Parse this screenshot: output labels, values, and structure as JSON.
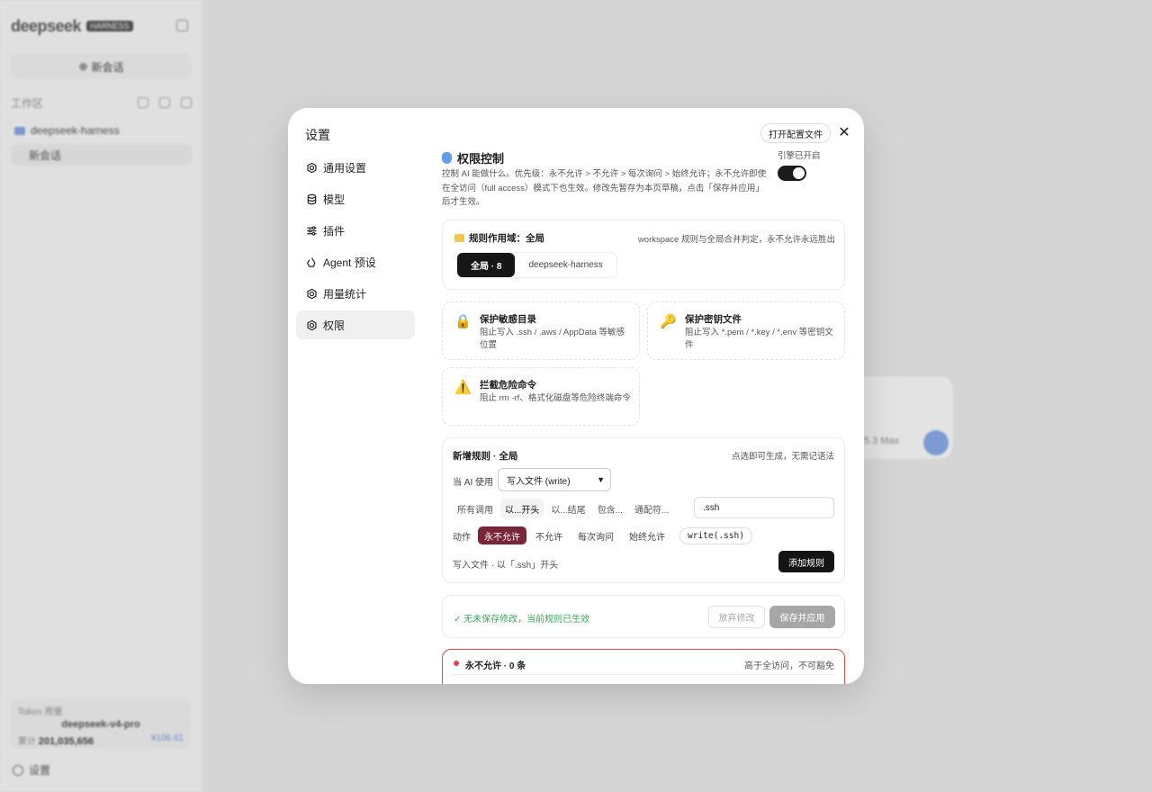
{
  "background": {
    "brand": "deepseek",
    "brand_badge": "HARNESS",
    "new_chat": "新会话",
    "workspace_label": "工作区",
    "workspace_item": "deepseek-harness",
    "chat_item": "新会话",
    "token_title": "Token 用量",
    "token_model": "deepseek-v4-pro",
    "token_total_label": "累计",
    "token_total": "201,035,656",
    "token_cost": "¥106.61",
    "settings": "设置",
    "composer_model": "5.3 Max"
  },
  "modal": {
    "title": "设置",
    "open_config": "打开配置文件",
    "nav": [
      {
        "label": "通用设置",
        "icon": "gear-icon"
      },
      {
        "label": "模型",
        "icon": "database-icon"
      },
      {
        "label": "插件",
        "icon": "sliders-icon"
      },
      {
        "label": "Agent 预设",
        "icon": "recycle-icon"
      },
      {
        "label": "用量统计",
        "icon": "gear-icon"
      },
      {
        "label": "权限",
        "icon": "gear-icon"
      }
    ],
    "active_nav": "权限"
  },
  "permissions": {
    "title": "权限控制",
    "description": "控制 AI 能做什么。优先级：永不允许 > 不允许 > 每次询问 > 始终允许；永不允许即使在全访问（full access）模式下也生效。修改先暂存为本页草稿，点击「保存并应用」后才生效。",
    "engine_label": "引擎已开启",
    "engine_on": true,
    "scope": {
      "title": "规则作用域：全局",
      "note": "workspace 规则与全局合并判定，永不允许永远胜出",
      "tabs": [
        "全局 · 8",
        "deepseek-harness"
      ]
    },
    "presets": [
      {
        "icon": "🔒",
        "title": "保护敏感目录",
        "desc": "阻止写入 .ssh / .aws / AppData 等敏感位置"
      },
      {
        "icon": "🔑",
        "title": "保护密钥文件",
        "desc": "阻止写入 *.pem / *.key / *.env 等密钥文件"
      },
      {
        "icon": "⚠️",
        "title": "拦截危险命令",
        "desc": "阻止 rm -rf、格式化磁盘等危险终端命令"
      }
    ],
    "new_rule": {
      "title": "新增规则 · 全局",
      "hint": "点选即可生成，无需记语法",
      "ai_label": "当 AI 使用",
      "tool_select": "写入文件 (write)",
      "match_types": [
        "所有调用",
        "以...开头",
        "以...结尾",
        "包含...",
        "通配符..."
      ],
      "active_match": "以...开头",
      "pattern_value": ".ssh",
      "action_label": "动作",
      "actions": [
        "永不允许",
        "不允许",
        "每次询问",
        "始终允许"
      ],
      "active_action": "永不允许",
      "preview": "write(.ssh)",
      "summary": "写入文件 · 以「.ssh」开头",
      "add_button": "添加规则"
    },
    "save_bar": {
      "status": "✓ 无未保存修改，当前规则已生效",
      "discard": "放弃修改",
      "apply": "保存并应用"
    },
    "deny_section": {
      "title": "永不允许 · 0 条",
      "note": "高于全访问，不可豁免"
    }
  }
}
